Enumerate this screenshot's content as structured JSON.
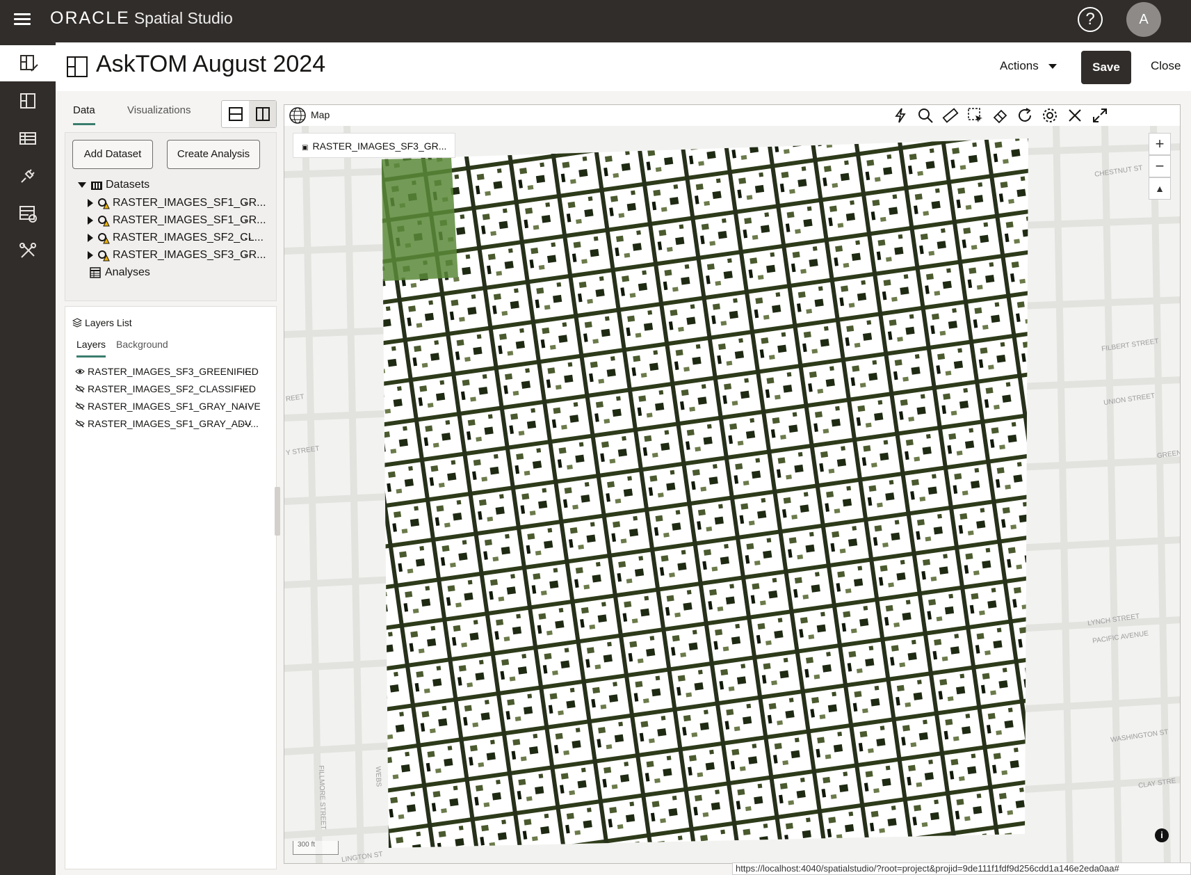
{
  "app": {
    "brand": "ORACLE",
    "product": "Spatial Studio",
    "avatar_initial": "A",
    "help_glyph": "?"
  },
  "header": {
    "title": "AskTOM August 2024",
    "actions_label": "Actions",
    "save_label": "Save",
    "close_label": "Close"
  },
  "panel": {
    "tabs": [
      {
        "label": "Data",
        "active": true
      },
      {
        "label": "Visualizations",
        "active": false
      }
    ],
    "add_dataset_label": "Add Dataset",
    "create_analysis_label": "Create Analysis",
    "datasets_label": "Datasets",
    "datasets": [
      {
        "name": "RASTER_IMAGES_SF1_GR..."
      },
      {
        "name": "RASTER_IMAGES_SF1_GR..."
      },
      {
        "name": "RASTER_IMAGES_SF2_CL..."
      },
      {
        "name": "RASTER_IMAGES_SF3_GR..."
      }
    ],
    "analyses_label": "Analyses",
    "more_glyph": "...",
    "layers_list_label": "Layers List",
    "layer_tabs": [
      {
        "label": "Layers",
        "active": true
      },
      {
        "label": "Background",
        "active": false
      }
    ],
    "layers": [
      {
        "name": "RASTER_IMAGES_SF3_GREENIFIED",
        "visible": true
      },
      {
        "name": "RASTER_IMAGES_SF2_CLASSIFIED",
        "visible": false
      },
      {
        "name": "RASTER_IMAGES_SF1_GRAY_NAIVE",
        "visible": false
      },
      {
        "name": "RASTER_IMAGES_SF1_GRAY_ADV...",
        "visible": false
      }
    ]
  },
  "map": {
    "title": "Map",
    "active_layer_chip": "RASTER_IMAGES_SF3_GR...",
    "zoom_in": "+",
    "zoom_out": "−",
    "scale_label": "300 ft",
    "info_glyph": "i",
    "streets": [
      "CHESTNUT ST",
      "FILBERT STREET",
      "UNION STREET",
      "GREEN ST",
      "LYNCH STREET",
      "PACIFIC AVENUE",
      "WASHINGTON ST",
      "CLAY STRE",
      "REET",
      "Y STREET",
      "FILLMORE STREET",
      "WEBS",
      "LINGTON ST"
    ],
    "tools": [
      "lightning-icon",
      "search-icon",
      "ruler-icon",
      "select-box-icon",
      "eraser-icon",
      "refresh-icon",
      "gear-icon",
      "close-icon",
      "expand-icon"
    ]
  },
  "status_url": "https://localhost:4040/spatialstudio/?root=project&projid=9de111f1fdf9d256cdd1a146e2eda0aa#"
}
